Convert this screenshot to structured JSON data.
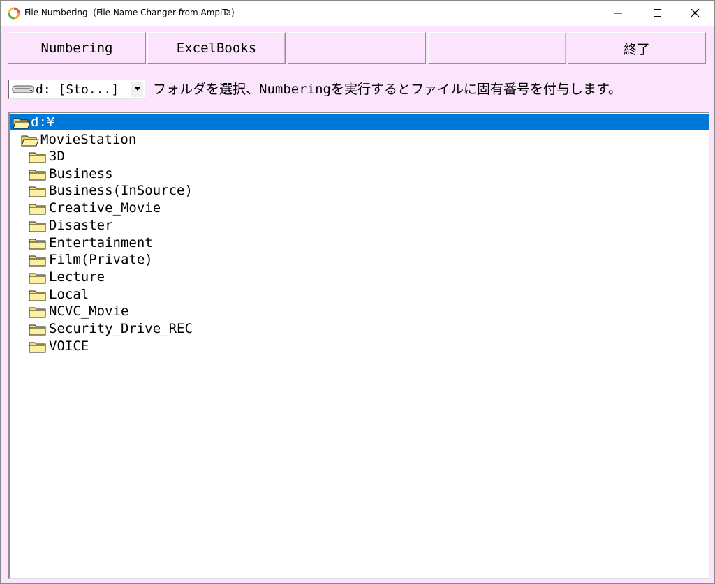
{
  "window": {
    "title": "File Numbering  (File Name Changer from AmpiTa)"
  },
  "toolbar": {
    "buttons": [
      {
        "label": "Numbering"
      },
      {
        "label": "ExcelBooks"
      },
      {
        "label": ""
      },
      {
        "label": ""
      },
      {
        "label": "終了"
      }
    ]
  },
  "drive_select": {
    "value": "d: [Sto...]"
  },
  "instruction": "フォルダを選択、Numberingを実行するとファイルに固有番号を付与します。",
  "tree": {
    "root": "d:¥",
    "parent": "MovieStation",
    "folders": [
      "3D",
      "Business",
      "Business(InSource)",
      "Creative_Movie",
      "Disaster",
      "Entertainment",
      "Film(Private)",
      "Lecture",
      "Local",
      "NCVC_Movie",
      "Security_Drive_REC",
      "VOICE"
    ]
  },
  "colors": {
    "background": "#fde4fd",
    "selection": "#0078d7",
    "folder": "#f4e27a"
  },
  "icons": {
    "app": "ampita-logo-icon",
    "drive": "hard-drive-icon",
    "open_folder": "open-folder-icon",
    "folder": "folder-icon"
  }
}
